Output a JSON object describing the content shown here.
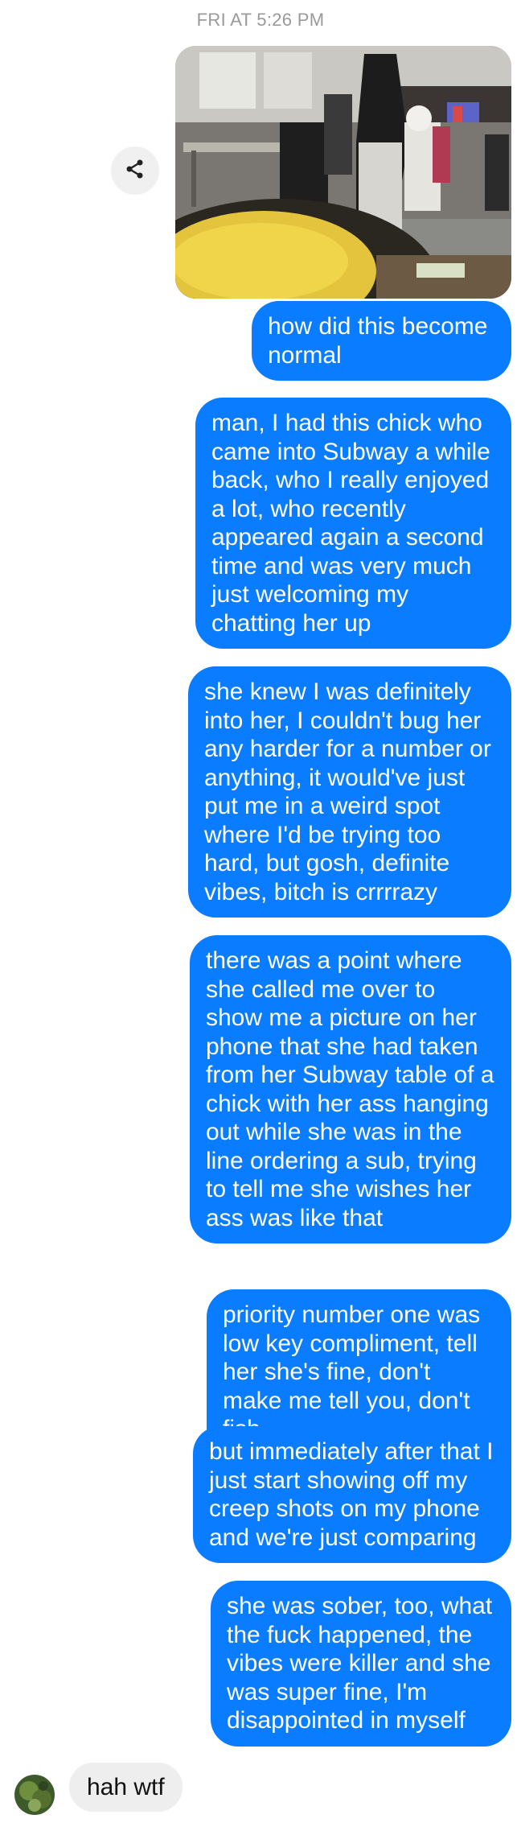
{
  "thread": {
    "timestamp": "FRI AT 5:26 PM"
  },
  "icons": {
    "share": "share-icon"
  },
  "messages": {
    "outgoing": [
      "how did this become normal",
      "man, I had this chick who came into Subway a while back, who I really enjoyed a lot, who recently appeared again a second time and was very much just welcoming my chatting her up",
      "she knew I was definitely into her, I couldn't bug her any harder for a number or anything, it would've just put me in a weird spot where I'd be trying too hard, but gosh, definite vibes, bitch is crrrrazy",
      "there was a point where she called me over to show me a picture on her phone that she had taken from her Subway table of a chick with her ass hanging out while she was in the line ordering a sub, trying to tell me she wishes her ass was like that",
      "priority number one was low key compliment, tell her she's fine, don't make me tell you, don't fish",
      "but immediately after that I just start showing off my creep shots on my phone and we're just comparing",
      "she was sober, too, what the fuck happened, the vibes were killer and she was super fine, I'm disappointed in myself"
    ],
    "incoming": [
      "hah wtf"
    ]
  },
  "colors": {
    "outgoing_bubble": "#0a7cff",
    "incoming_bubble": "#eeeeee",
    "timestamp": "#9a9a9a"
  }
}
